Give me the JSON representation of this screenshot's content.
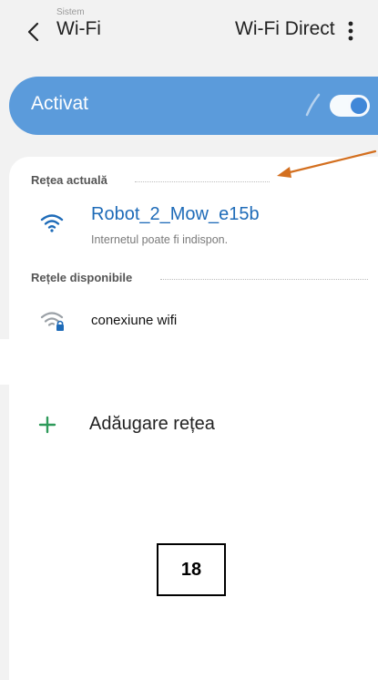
{
  "header": {
    "title": "Wi-Fi",
    "overlay_label": "Sistem",
    "wifi_direct_label": "Wi-Fi Direct",
    "back_icon": "chevron-left-icon",
    "more_icon": "more-vertical-icon"
  },
  "master_switch": {
    "label": "Activat",
    "state": "on",
    "bar_color": "#5b9bdb"
  },
  "current_network": {
    "section_title": "Rețea actuală",
    "name": "Robot_2_Mow_e15b",
    "status": "Internetul poate fi indispon.",
    "icon": "wifi-signal-icon",
    "name_color": "#1e6bb8"
  },
  "available_networks": {
    "section_title": "Rețele disponibile",
    "items": [
      {
        "name": "conexiune wifi",
        "icon": "wifi-locked-icon"
      }
    ]
  },
  "add_network": {
    "label": "Adăugare rețea",
    "icon": "plus-icon",
    "icon_color": "#2e9a5a"
  },
  "annotation": {
    "page_number": "18",
    "arrow_color": "#d36f1f"
  }
}
